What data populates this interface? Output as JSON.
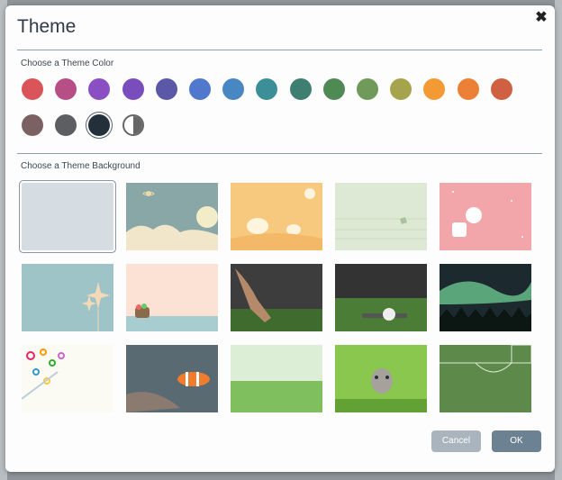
{
  "dialog": {
    "title": "Theme",
    "close_glyph": "✖",
    "color_section_label": "Choose a Theme Color",
    "background_section_label": "Choose a Theme Background",
    "cancel_label": "Cancel",
    "ok_label": "OK"
  },
  "theme_colors": [
    "#d95559",
    "#b74e86",
    "#8a4fc2",
    "#7a4dbd",
    "#5b58a8",
    "#5078cc",
    "#4887c2",
    "#3d8f97",
    "#3f7f72",
    "#4f8a55",
    "#6f9a5a",
    "#a5a34b",
    "#f49a35",
    "#ec8037",
    "#cf6142",
    "#7c6162",
    "#5d5e61",
    "#23303b",
    "contrast"
  ],
  "selected_color_index": 17,
  "theme_backgrounds": [
    "plain-gray",
    "space-planets",
    "elephant-orange",
    "green-lines",
    "pink-balloon",
    "teal-sparkle",
    "peach-basket",
    "hand-on-grass",
    "baseball-on-grass",
    "aurora-forest",
    "color-circles",
    "clownfish",
    "green-gradient",
    "kitten-in-grass",
    "soccer-field"
  ],
  "selected_background_index": 0
}
